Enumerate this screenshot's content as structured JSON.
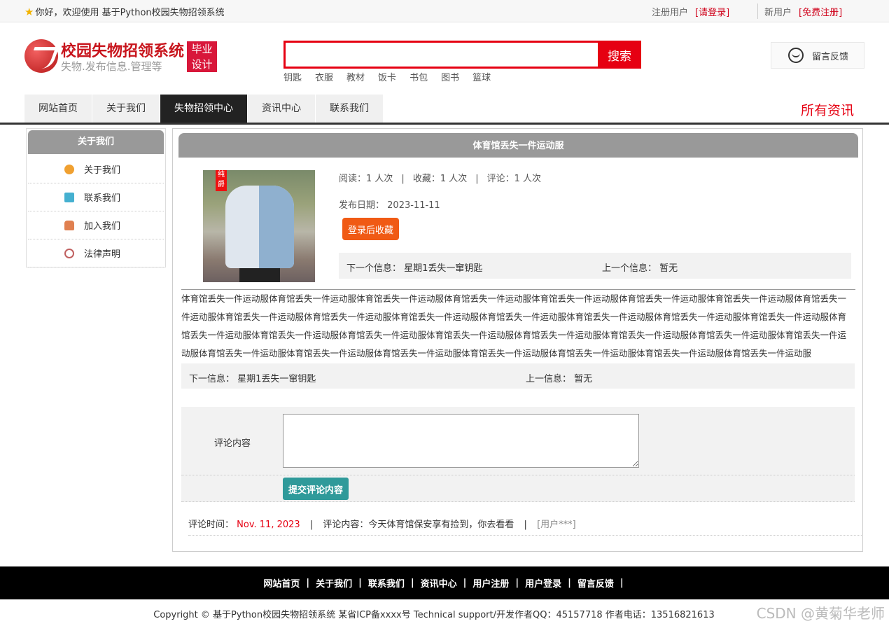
{
  "topbar": {
    "welcome": "你好，欢迎使用 基于Python校园失物招领系统",
    "reg_user": "注册用户",
    "login_link": "[请登录]",
    "new_user": "新用户",
    "register_link": "[免费注册]"
  },
  "header": {
    "logo_title": "校园失物招领系统",
    "logo_sub": "失物.发布信息.管理等",
    "badge_line1": "毕业",
    "badge_line2": "设计",
    "search_placeholder": "",
    "search_btn": "搜索",
    "hotwords": [
      "钥匙",
      "衣服",
      "教材",
      "饭卡",
      "书包",
      "图书",
      "篮球"
    ],
    "feedback": "留言反馈"
  },
  "nav": {
    "items": [
      "网站首页",
      "关于我们",
      "失物招领中心",
      "资讯中心",
      "联系我们"
    ],
    "active": 2,
    "all_news": "所有资讯"
  },
  "sidebar": {
    "title": "关于我们",
    "items": [
      {
        "label": "关于我们",
        "icon": "orange-circle-icon",
        "color": "#f0a030"
      },
      {
        "label": "联系我们",
        "icon": "clipboard-icon",
        "color": "#45b0d0"
      },
      {
        "label": "加入我们",
        "icon": "lock-icon",
        "color": "#e08050"
      },
      {
        "label": "法律声明",
        "icon": "power-icon",
        "color": "#c06060"
      }
    ]
  },
  "detail": {
    "title": "体育馆丢失一件运动服",
    "read_label": "阅读：",
    "read_value": "1 人次",
    "fav_label": "收藏：",
    "fav_value": "1 人次",
    "comment_label": "评论：",
    "comment_value": "1 人次",
    "date_label": "发布日期：",
    "date_value": "2023-11-11",
    "collect_btn": "登录后收藏",
    "next_label": "下一个信息：",
    "next_value": "星期1丢失一窜钥匙",
    "prev_label": "上一个信息：",
    "prev_value": "暂无",
    "photo_tag": "纯爵",
    "content": "体育馆丢失一件运动服体育馆丢失一件运动服体育馆丢失一件运动服体育馆丢失一件运动服体育馆丢失一件运动服体育馆丢失一件运动服体育馆丢失一件运动服体育馆丢失一件运动服体育馆丢失一件运动服体育馆丢失一件运动服体育馆丢失一件运动服体育馆丢失一件运动服体育馆丢失一件运动服体育馆丢失一件运动服体育馆丢失一件运动服体育馆丢失一件运动服体育馆丢失一件运动服体育馆丢失一件运动服体育馆丢失一件运动服体育馆丢失一件运动服体育馆丢失一件运动服体育馆丢失一件运动服体育馆丢失一件运动服体育馆丢失一件运动服体育馆丢失一件运动服体育馆丢失一件运动服体育馆丢失一件运动服体育馆丢失一件运动服体育馆丢失一件运动服体育馆丢失一件运动服",
    "bottom_next_label": "下一信息：",
    "bottom_next_value": "星期1丢失一窜钥匙",
    "bottom_prev_label": "上一信息：",
    "bottom_prev_value": "暂无"
  },
  "comment": {
    "label": "评论内容",
    "submit": "提交评论内容",
    "time_label": "评论时间：",
    "time_value": "Nov. 11, 2023",
    "content_label": "评论内容：",
    "content_value": "今天体育馆保安享有捡到，你去看看",
    "user": "[用户***]"
  },
  "footer": {
    "links": [
      "网站首页",
      "关于我们",
      "联系我们",
      "资讯中心",
      "用户注册",
      "用户登录",
      "留言反馈"
    ],
    "copyright": "Copyright © 基于Python校园失物招领系统 某省ICP备xxxx号    Technical support/开发作者QQ：45157718    作者电话：13516821613",
    "watermark": "CSDN @黄菊华老师"
  }
}
